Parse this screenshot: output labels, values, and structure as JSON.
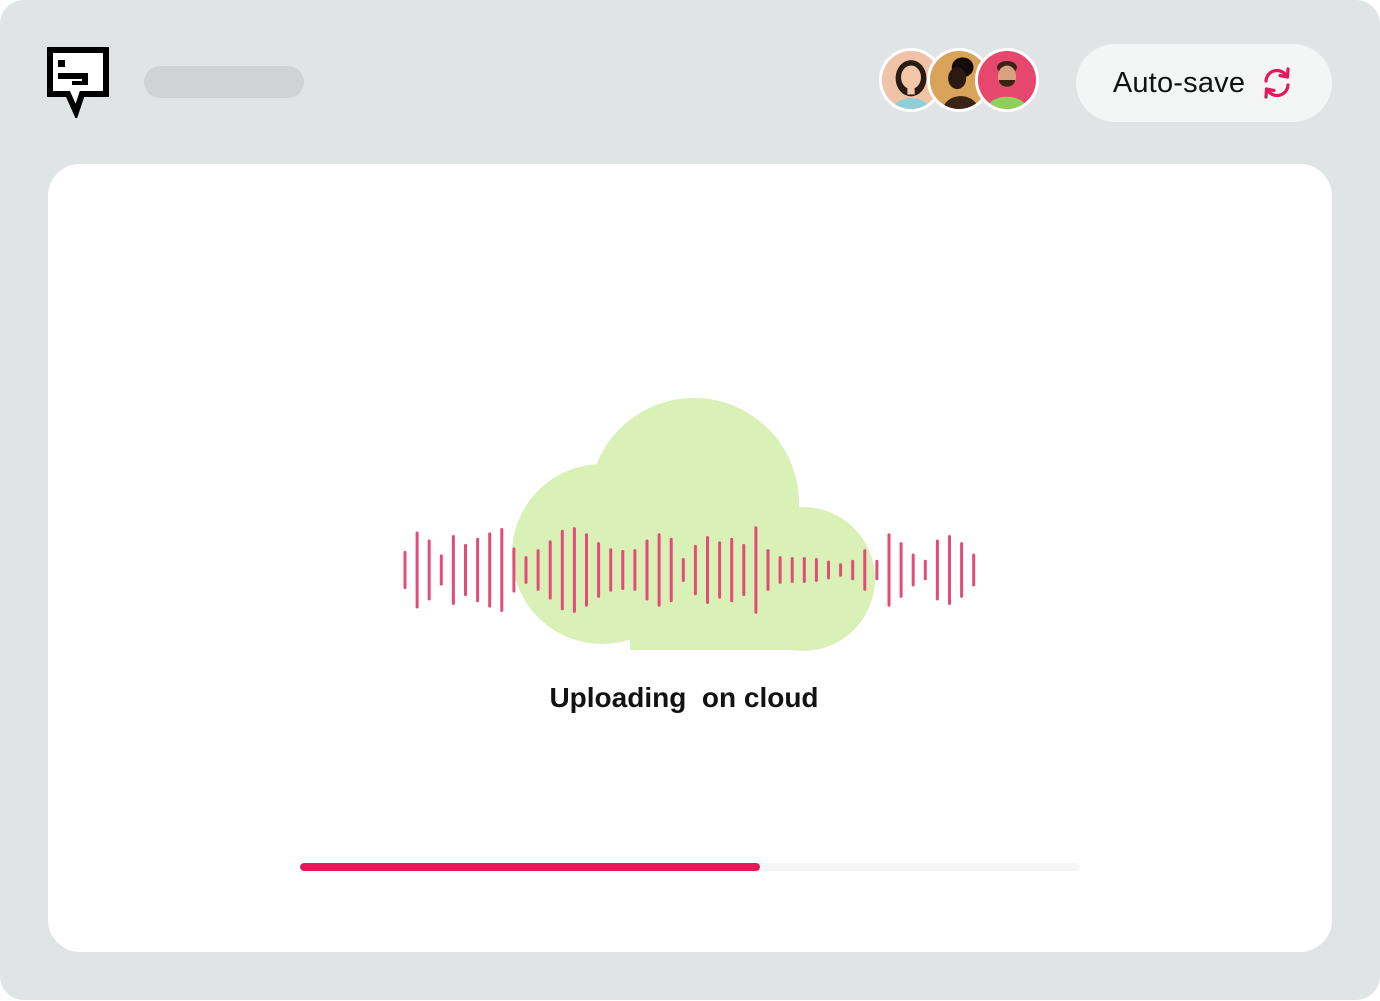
{
  "header": {
    "logo_icon": "chat-bubble-logo-icon",
    "autosave_label": "Auto-save",
    "autosave_icon": "sync-icon",
    "collaborators": [
      {
        "name_icon": "avatar-woman-smiling",
        "bg": "#f0c3a6",
        "skin": "#f3c7a8",
        "hair": "#2a1b14",
        "shirt": "#8fd0d8"
      },
      {
        "name_icon": "avatar-woman-profile",
        "bg": "#d9a35a",
        "skin": "#2a1a12",
        "hair": "#130c08",
        "shirt": "#3a2418"
      },
      {
        "name_icon": "avatar-man-beard",
        "bg": "#e8476d",
        "skin": "#d8a27e",
        "hair": "#3a2216",
        "shirt": "#8fcf5a"
      }
    ]
  },
  "upload": {
    "status_text": "Uploading  on cloud",
    "progress_percent": 59,
    "illustration_icon": "cloud-soundwave-icon"
  },
  "colors": {
    "accent": "#e3195a",
    "wave": "#e44c78",
    "cloud": "#d9f1b6",
    "frame": "#e1e4e5"
  },
  "waveform_levels": [
    0.4,
    0.84,
    0.66,
    0.32,
    0.76,
    0.56,
    0.7,
    0.82,
    0.92,
    0.48,
    0.28,
    0.44,
    0.64,
    0.88,
    0.94,
    0.8,
    0.6,
    0.46,
    0.42,
    0.44,
    0.66,
    0.8,
    0.7,
    0.24,
    0.54,
    0.74,
    0.62,
    0.7,
    0.56,
    0.96,
    0.44,
    0.28,
    0.26,
    0.26,
    0.24,
    0.18,
    0.12,
    0.2,
    0.44,
    0.2,
    0.8,
    0.6,
    0.34,
    0.2,
    0.66,
    0.76,
    0.6,
    0.34
  ]
}
